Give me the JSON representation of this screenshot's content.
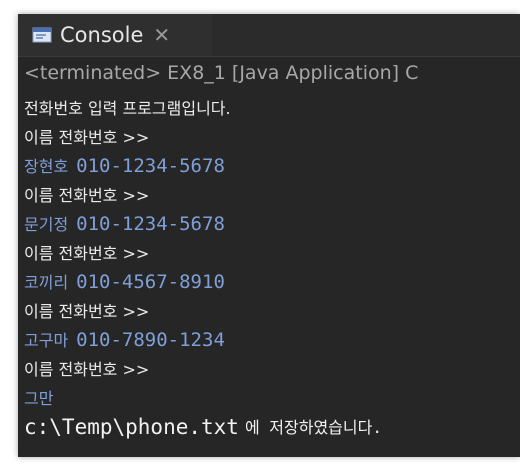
{
  "tab": {
    "label": "Console",
    "icon": "console-icon",
    "close_icon": "close-icon"
  },
  "status": "<terminated> EX8_1 [Java Application] C",
  "lines": [
    {
      "type": "stdout",
      "text": "전화번호 입력 프로그램입니다."
    },
    {
      "type": "stdout",
      "text": "이름 전화번호 >>"
    },
    {
      "type": "stdin",
      "name": "장현호",
      "number": "010-1234-5678"
    },
    {
      "type": "stdout",
      "text": "이름 전화번호 >>"
    },
    {
      "type": "stdin",
      "name": "문기정",
      "number": "010-1234-5678"
    },
    {
      "type": "stdout",
      "text": "이름 전화번호 >>"
    },
    {
      "type": "stdin",
      "name": "코끼리",
      "number": "010-4567-8910"
    },
    {
      "type": "stdout",
      "text": "이름 전화번호 >>"
    },
    {
      "type": "stdin",
      "name": "고구마",
      "number": "010-7890-1234"
    },
    {
      "type": "stdout",
      "text": "이름 전화번호 >>"
    },
    {
      "type": "stdin",
      "name": "그만",
      "number": ""
    }
  ],
  "final_line": {
    "path": "c:\\Temp\\phone.txt",
    "message": "에 저장하였습니다."
  },
  "colors": {
    "background": "#262626",
    "stdout": "#ebebeb",
    "stdin": "#7f9fd8",
    "status": "#a8a8a8"
  }
}
